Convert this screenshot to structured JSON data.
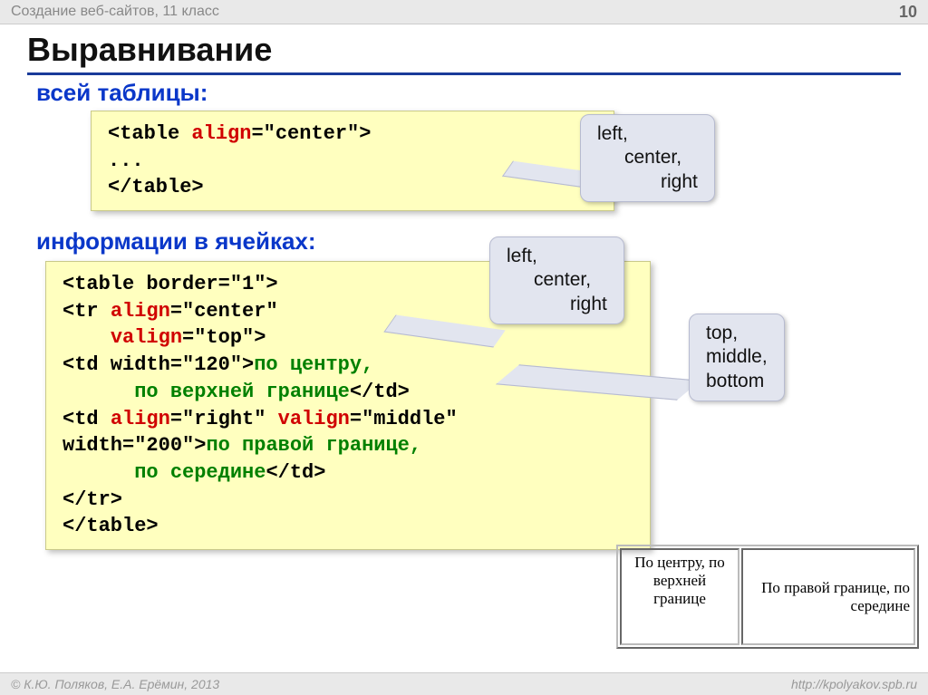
{
  "header": {
    "course": "Создание веб-сайтов, 11 класс",
    "page": "10"
  },
  "title": "Выравнивание",
  "sections": {
    "whole_table": "всей таблицы:",
    "cell_info": "информации в ячейках:"
  },
  "code1": {
    "l1_a": "<table ",
    "l1_attr": "align",
    "l1_b": "=\"center\">",
    "l2": "...",
    "l3": "</table>"
  },
  "code2": {
    "l1": "<table border=\"1\">",
    "l2_a": "<tr ",
    "l2_attr": "align",
    "l2_b": "=\"center\"",
    "l3_attr": "valign",
    "l3_b": "=\"top\">",
    "l4_a": "  <td width=\"120\">",
    "l4_b": "по центру,",
    "l5_a": "по верхней границе",
    "l5_b": "</td>",
    "l6_a": "  <td ",
    "l6_attr1": "align",
    "l6_b": "=\"right\" ",
    "l6_attr2": "valign",
    "l6_c": "=\"middle\"",
    "l7_a": "      width=\"200\">",
    "l7_b": "по правой границе,",
    "l8_a": "по середине",
    "l8_b": "</td>",
    "l9": "</tr>",
    "l10": "</table>"
  },
  "callouts": {
    "c1": {
      "v1": "left,",
      "v2": "center,",
      "v3": "right"
    },
    "c2": {
      "v1": "left,",
      "v2": "center,",
      "v3": "right"
    },
    "c3": {
      "v1": "top,",
      "v2": "middle,",
      "v3": "bottom"
    }
  },
  "demo": {
    "cell1": "По центру, по верхней границе",
    "cell2": "По правой границе, по середине"
  },
  "footer": {
    "copyright": "© К.Ю. Поляков, Е.А. Ерёмин, 2013",
    "url": "http://kpolyakov.spb.ru"
  }
}
